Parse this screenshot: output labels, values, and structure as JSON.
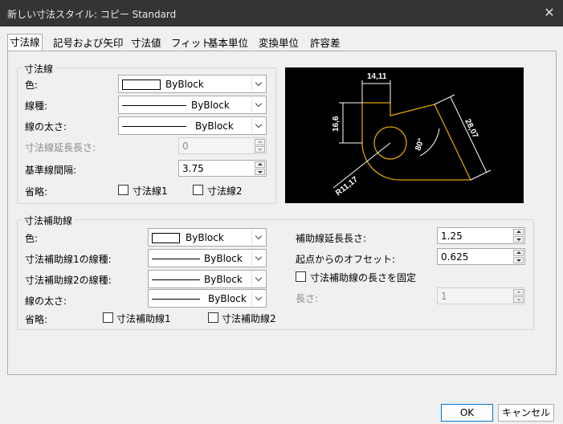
{
  "window": {
    "title": "新しい寸法スタイル: コピー Standard",
    "close_glyph": "✕"
  },
  "tabs": [
    {
      "label": "寸法線",
      "active": true
    },
    {
      "label": "記号および矢印",
      "active": false
    },
    {
      "label": "寸法値",
      "active": false
    },
    {
      "label": "フィット",
      "active": false
    },
    {
      "label": "基本単位",
      "active": false
    },
    {
      "label": "変換単位",
      "active": false
    },
    {
      "label": "許容差",
      "active": false
    }
  ],
  "dim_lines": {
    "title": "寸法線",
    "color_label": "色:",
    "color_value": "ByBlock",
    "linetype_label": "線種:",
    "linetype_value": "ByBlock",
    "lineweight_label": "線の太さ:",
    "lineweight_value": "ByBlock",
    "extend_label": "寸法線延長長さ:",
    "extend_value": "0",
    "baseline_label": "基準線間隔:",
    "baseline_value": "3.75",
    "suppress_label": "省略:",
    "suppress_1": "寸法線1",
    "suppress_2": "寸法線2"
  },
  "ext_lines": {
    "title": "寸法補助線",
    "color_label": "色:",
    "color_value": "ByBlock",
    "linetype1_label": "寸法補助線1の線種:",
    "linetype1_value": "ByBlock",
    "linetype2_label": "寸法補助線2の線種:",
    "linetype2_value": "ByBlock",
    "lineweight_label": "線の太さ:",
    "lineweight_value": "ByBlock",
    "suppress_label": "省略:",
    "suppress_1": "寸法補助線1",
    "suppress_2": "寸法補助線2",
    "extend_beyond_label": "補助線延長長さ:",
    "extend_beyond_value": "1.25",
    "offset_label": "起点からのオフセット:",
    "offset_value": "0.625",
    "fixed_length_label": "寸法補助線の長さを固定",
    "length_label": "長さ:",
    "length_value": "1"
  },
  "preview": {
    "dim_top": "14,11",
    "dim_left": "16,6",
    "dim_right": "28,07",
    "dim_angle": "80°",
    "dim_radius": "R11,17",
    "colors": {
      "background": "#000000",
      "geometry": "#e0a000",
      "dims": "#ffffff"
    }
  },
  "buttons": {
    "ok": "OK",
    "cancel": "キャンセル"
  }
}
